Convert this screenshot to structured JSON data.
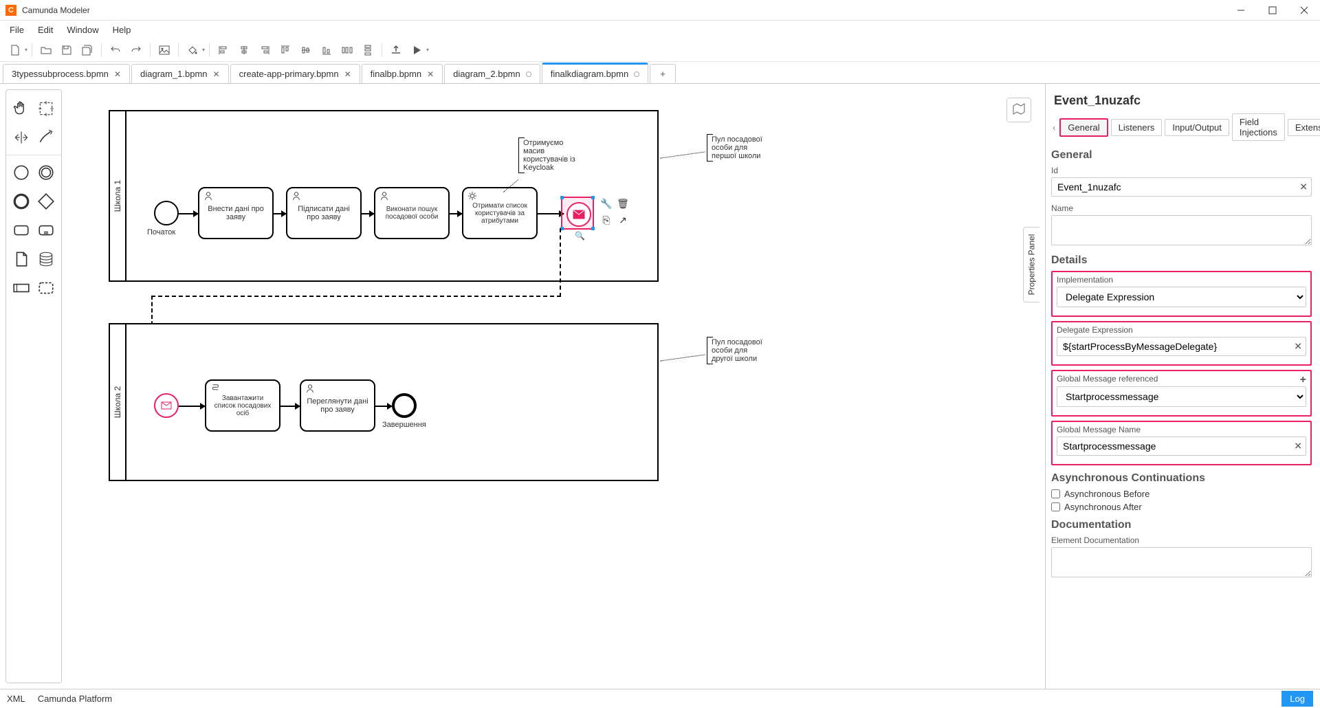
{
  "app": {
    "title": "Camunda Modeler"
  },
  "menu": {
    "file": "File",
    "edit": "Edit",
    "window": "Window",
    "help": "Help"
  },
  "tabs": [
    {
      "label": "3typessubprocess.bpmn",
      "dirty": false
    },
    {
      "label": "diagram_1.bpmn",
      "dirty": false
    },
    {
      "label": "create-app-primary.bpmn",
      "dirty": false
    },
    {
      "label": "finalbp.bpmn",
      "dirty": false
    },
    {
      "label": "diagram_2.bpmn",
      "dirty": true
    },
    {
      "label": "finalkdiagram.bpmn",
      "dirty": true,
      "active": true
    }
  ],
  "pools": {
    "p1": {
      "label": "Школа 1"
    },
    "p2": {
      "label": "Школа 2"
    }
  },
  "elements": {
    "start1": "Початок",
    "task1": "Внести дані про заяву",
    "task2": "Підписати дані про заяву",
    "task3": "Виконати пошук посадової особи",
    "task4": "Отримати список користувачів за атрибутами",
    "ann1": "Отримуємо масив користувачів із Keycloak",
    "annP1": "Пул посадової особи для першої школи",
    "annP2": "Пул посадової особи для другої школи",
    "taskA": "Завантажити список посадових осіб",
    "taskB": "Переглянути дані про заяву",
    "end2": "Завершення"
  },
  "props": {
    "title": "Event_1nuzafc",
    "tabs": {
      "general": "General",
      "listeners": "Listeners",
      "io": "Input/Output",
      "field": "Field Injections",
      "ext": "Extensions"
    },
    "general": {
      "section": "General",
      "idLabel": "Id",
      "idValue": "Event_1nuzafc",
      "nameLabel": "Name",
      "nameValue": ""
    },
    "details": {
      "section": "Details",
      "implLabel": "Implementation",
      "implValue": "Delegate Expression",
      "delLabel": "Delegate Expression",
      "delValue": "${startProcessByMessageDelegate}",
      "gmRefLabel": "Global Message referenced",
      "gmRefValue": "Startprocessmessage",
      "gmNameLabel": "Global Message Name",
      "gmNameValue": "Startprocessmessage"
    },
    "async": {
      "section": "Asynchronous Continuations",
      "before": "Asynchronous Before",
      "after": "Asynchronous After"
    },
    "doc": {
      "section": "Documentation",
      "label": "Element Documentation",
      "value": ""
    }
  },
  "propsToggle": "Properties Panel",
  "footer": {
    "xml": "XML",
    "platform": "Camunda Platform",
    "log": "Log"
  }
}
